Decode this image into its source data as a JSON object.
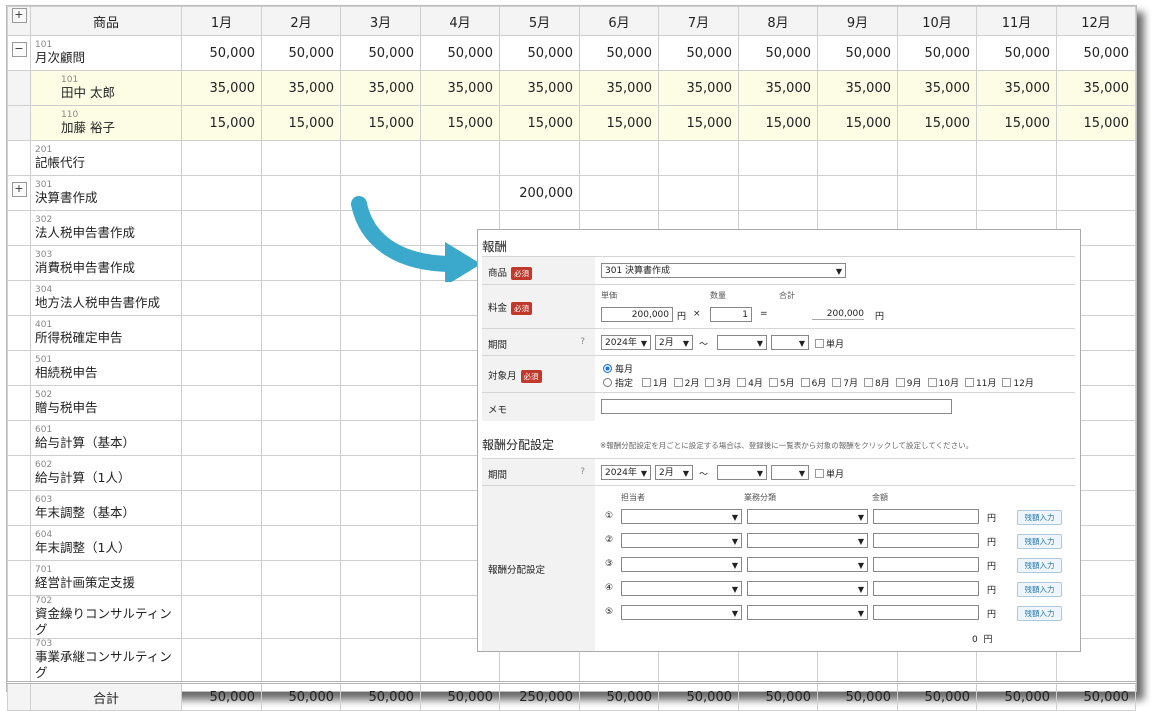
{
  "table": {
    "header": {
      "toggle": "+",
      "product": "商品",
      "months": [
        "1月",
        "2月",
        "3月",
        "4月",
        "5月",
        "6月",
        "7月",
        "8月",
        "9月",
        "10月",
        "11月",
        "12月"
      ]
    },
    "rows": [
      {
        "toggle": "−",
        "code": "101",
        "name": "月次顧問",
        "values": [
          "50,000",
          "50,000",
          "50,000",
          "50,000",
          "50,000",
          "50,000",
          "50,000",
          "50,000",
          "50,000",
          "50,000",
          "50,000",
          "50,000"
        ],
        "sub": false
      },
      {
        "toggle": "",
        "code": "101",
        "name": "田中 太郎",
        "values": [
          "35,000",
          "35,000",
          "35,000",
          "35,000",
          "35,000",
          "35,000",
          "35,000",
          "35,000",
          "35,000",
          "35,000",
          "35,000",
          "35,000"
        ],
        "sub": true
      },
      {
        "toggle": "",
        "code": "110",
        "name": "加藤 裕子",
        "values": [
          "15,000",
          "15,000",
          "15,000",
          "15,000",
          "15,000",
          "15,000",
          "15,000",
          "15,000",
          "15,000",
          "15,000",
          "15,000",
          "15,000"
        ],
        "sub": true
      },
      {
        "toggle": "",
        "code": "201",
        "name": "記帳代行",
        "values": [
          "",
          "",
          "",
          "",
          "",
          "",
          "",
          "",
          "",
          "",
          "",
          ""
        ],
        "sub": false
      },
      {
        "toggle": "+",
        "code": "301",
        "name": "決算書作成",
        "values": [
          "",
          "",
          "",
          "",
          "200,000",
          "",
          "",
          "",
          "",
          "",
          "",
          ""
        ],
        "sub": false
      },
      {
        "toggle": "",
        "code": "302",
        "name": "法人税申告書作成",
        "values": [
          "",
          "",
          "",
          "",
          "",
          "",
          "",
          "",
          "",
          "",
          "",
          ""
        ],
        "sub": false
      },
      {
        "toggle": "",
        "code": "303",
        "name": "消費税申告書作成",
        "values": [
          "",
          "",
          "",
          "",
          "",
          "",
          "",
          "",
          "",
          "",
          "",
          ""
        ],
        "sub": false
      },
      {
        "toggle": "",
        "code": "304",
        "name": "地方法人税申告書作成",
        "values": [
          "",
          "",
          "",
          "",
          "",
          "",
          "",
          "",
          "",
          "",
          "",
          ""
        ],
        "sub": false
      },
      {
        "toggle": "",
        "code": "401",
        "name": "所得税確定申告",
        "values": [
          "",
          "",
          "",
          "",
          "",
          "",
          "",
          "",
          "",
          "",
          "",
          ""
        ],
        "sub": false
      },
      {
        "toggle": "",
        "code": "501",
        "name": "相続税申告",
        "values": [
          "",
          "",
          "",
          "",
          "",
          "",
          "",
          "",
          "",
          "",
          "",
          ""
        ],
        "sub": false
      },
      {
        "toggle": "",
        "code": "502",
        "name": "贈与税申告",
        "values": [
          "",
          "",
          "",
          "",
          "",
          "",
          "",
          "",
          "",
          "",
          "",
          ""
        ],
        "sub": false
      },
      {
        "toggle": "",
        "code": "601",
        "name": "給与計算（基本）",
        "values": [
          "",
          "",
          "",
          "",
          "",
          "",
          "",
          "",
          "",
          "",
          "",
          ""
        ],
        "sub": false
      },
      {
        "toggle": "",
        "code": "602",
        "name": "給与計算（1人）",
        "values": [
          "",
          "",
          "",
          "",
          "",
          "",
          "",
          "",
          "",
          "",
          "",
          ""
        ],
        "sub": false
      },
      {
        "toggle": "",
        "code": "603",
        "name": "年末調整（基本）",
        "values": [
          "",
          "",
          "",
          "",
          "",
          "",
          "",
          "",
          "",
          "",
          "",
          ""
        ],
        "sub": false
      },
      {
        "toggle": "",
        "code": "604",
        "name": "年末調整（1人）",
        "values": [
          "",
          "",
          "",
          "",
          "",
          "",
          "",
          "",
          "",
          "",
          "",
          ""
        ],
        "sub": false
      },
      {
        "toggle": "",
        "code": "701",
        "name": "経営計画策定支援",
        "values": [
          "",
          "",
          "",
          "",
          "",
          "",
          "",
          "",
          "",
          "",
          "",
          ""
        ],
        "sub": false
      },
      {
        "toggle": "",
        "code": "702",
        "name": "資金繰りコンサルティング",
        "values": [
          "",
          "",
          "",
          "",
          "",
          "",
          "",
          "",
          "",
          "",
          "",
          ""
        ],
        "sub": false
      },
      {
        "toggle": "",
        "code": "703",
        "name": "事業承継コンサルティング",
        "values": [
          "",
          "",
          "",
          "",
          "",
          "",
          "",
          "",
          "",
          "",
          "",
          ""
        ],
        "sub": false
      }
    ],
    "total": {
      "label": "合計",
      "values": [
        "50,000",
        "50,000",
        "50,000",
        "50,000",
        "250,000",
        "50,000",
        "50,000",
        "50,000",
        "50,000",
        "50,000",
        "50,000",
        "50,000"
      ]
    }
  },
  "panel": {
    "title": "報酬",
    "required": "必須",
    "product_label": "商品",
    "product_value": "301 決算書作成",
    "fee_label": "料金",
    "unit_price_label": "単価",
    "unit_price_value": "200,000",
    "yen": "円",
    "times": "×",
    "qty_label": "数量",
    "qty_value": "1",
    "equals": "=",
    "total_label": "合計",
    "total_value": "200,000",
    "period_label": "期間",
    "help_glyph": "?",
    "year_value": "2024年",
    "month_value": "2月",
    "tilde": "〜",
    "single_month": "単月",
    "target_label": "対象月",
    "opt_monthly": "毎月",
    "opt_specify": "指定",
    "months": [
      "1月",
      "2月",
      "3月",
      "4月",
      "5月",
      "6月",
      "7月",
      "8月",
      "9月",
      "10月",
      "11月",
      "12月"
    ],
    "memo_label": "メモ",
    "dist_title": "報酬分配設定",
    "dist_note": "※報酬分配設定を月ごとに設定する場合は、登録後に一覧表から対象の報酬をクリックして設定してください。",
    "dist_period_label": "期間",
    "dist_setting_label": "報酬分配設定",
    "col_person": "担当者",
    "col_category": "業務分類",
    "col_amount": "金額",
    "row_numbers": [
      "①",
      "②",
      "③",
      "④",
      "⑤"
    ],
    "remaining_btn": "残額入力",
    "dist_total": "0",
    "colors": {
      "required_badge": "#c0392b",
      "arrow": "#3aa9cc",
      "sub_row_bg": "#fdfde6"
    }
  }
}
